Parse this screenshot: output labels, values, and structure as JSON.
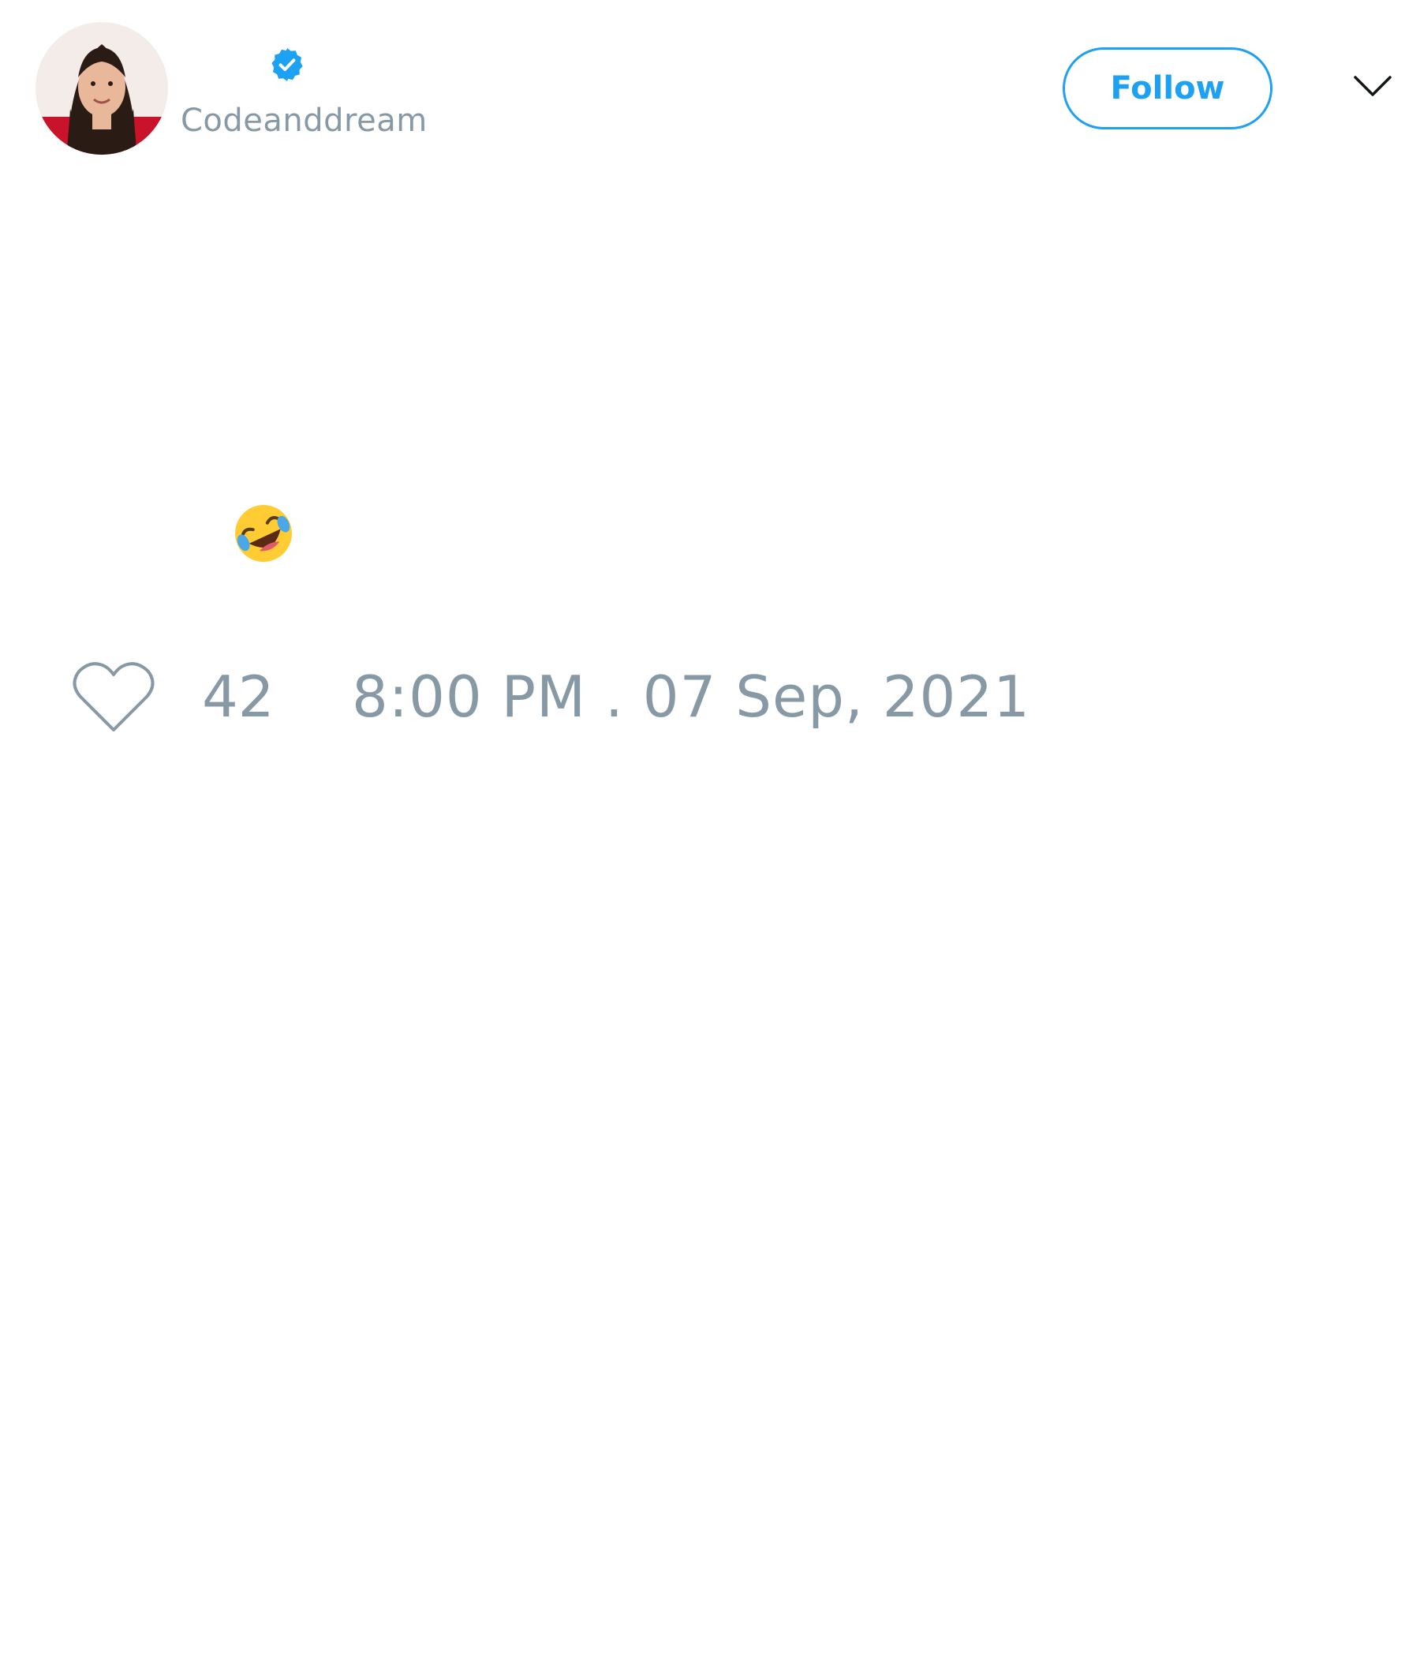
{
  "tweet": {
    "author": {
      "avatar_icon": "profile-photo",
      "verified_icon": "verified-badge-icon",
      "username": "Codeanddream"
    },
    "follow_label": "Follow",
    "menu_icon": "chevron-down-icon",
    "text_emoji": "🤣",
    "like_icon": "heart-icon",
    "likes": "42",
    "timestamp": "8:00 PM . 07 Sep, 2021"
  },
  "colors": {
    "accent": "#1da1f2",
    "muted_text": "#8899a6",
    "background": "#ffffff"
  }
}
